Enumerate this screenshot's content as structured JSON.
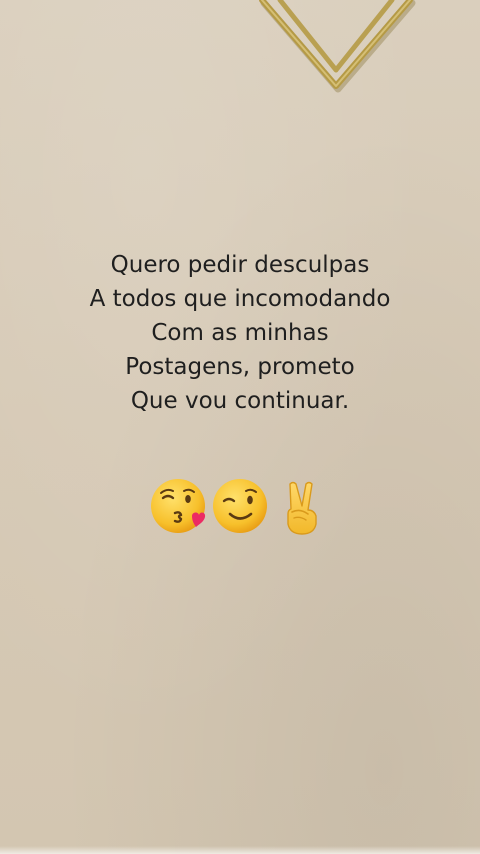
{
  "message": {
    "lines": [
      "Quero pedir desculpas",
      "A todos que incomodando",
      "Com as minhas",
      "Postagens, prometo",
      "Que vou continuar."
    ]
  },
  "emojis": [
    "face-blowing-a-kiss-icon",
    "winking-face-icon",
    "victory-hand-icon"
  ],
  "colors": {
    "background": "#d7cbb7",
    "text": "#1f1f1f",
    "clip": "#b59a45",
    "emoji_yellow": "#f7c02b"
  }
}
